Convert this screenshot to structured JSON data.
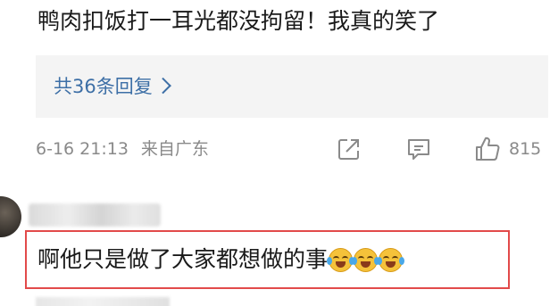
{
  "comment": {
    "text": "鸭肉扣饭打一耳光都没拘留！我真的笑了"
  },
  "replies": {
    "link_label": "共36条回复"
  },
  "meta": {
    "timestamp": "6-16 21:13",
    "source": "来自广东",
    "like_count": "815"
  },
  "reply": {
    "text": "啊他只是做了大家都想做的事",
    "emojis": [
      "laugh-cry-emoji",
      "laugh-cry-emoji",
      "laugh-cry-emoji"
    ]
  },
  "colors": {
    "link": "#3d6fa6",
    "meta": "#8a8a8a",
    "highlight_border": "#e24a4a",
    "replies_bg": "#f4f4f4"
  }
}
